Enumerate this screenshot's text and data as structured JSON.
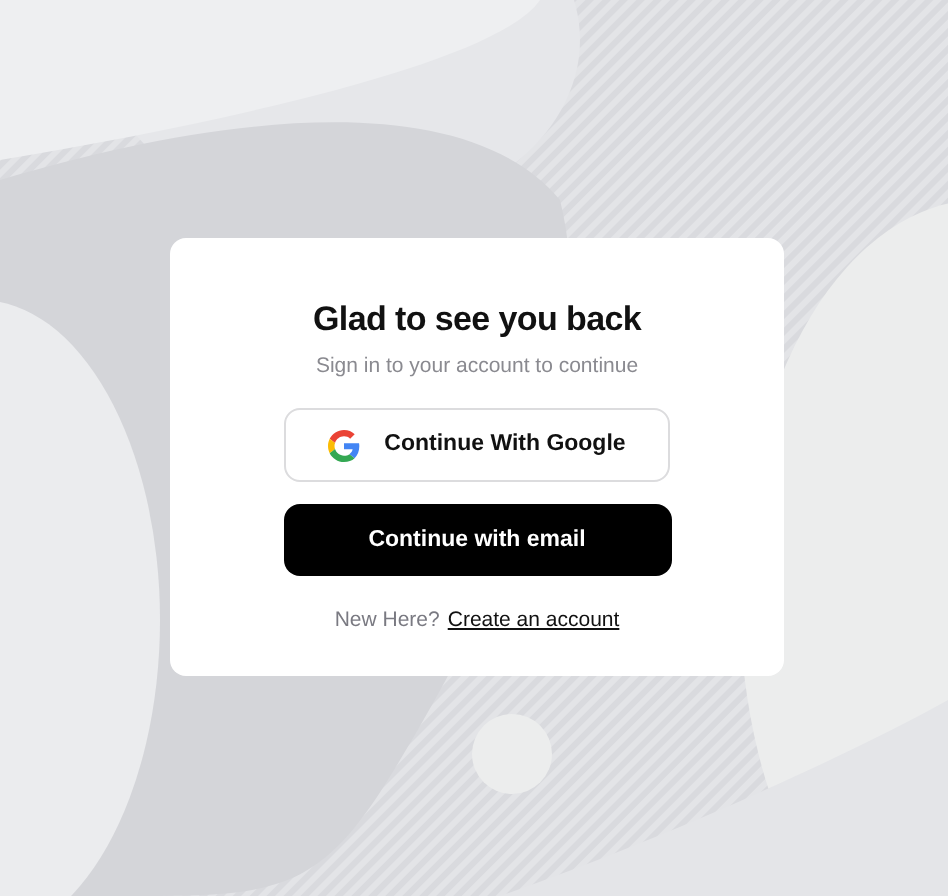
{
  "card": {
    "title": "Glad to see you back",
    "subtitle": "Sign in to your account to continue",
    "buttons": [
      {
        "kind": "google",
        "label": "Continue With Google"
      },
      {
        "kind": "email",
        "label": "Continue with email"
      }
    ],
    "footer": {
      "prompt": "New Here?",
      "link": "Create an account"
    }
  }
}
